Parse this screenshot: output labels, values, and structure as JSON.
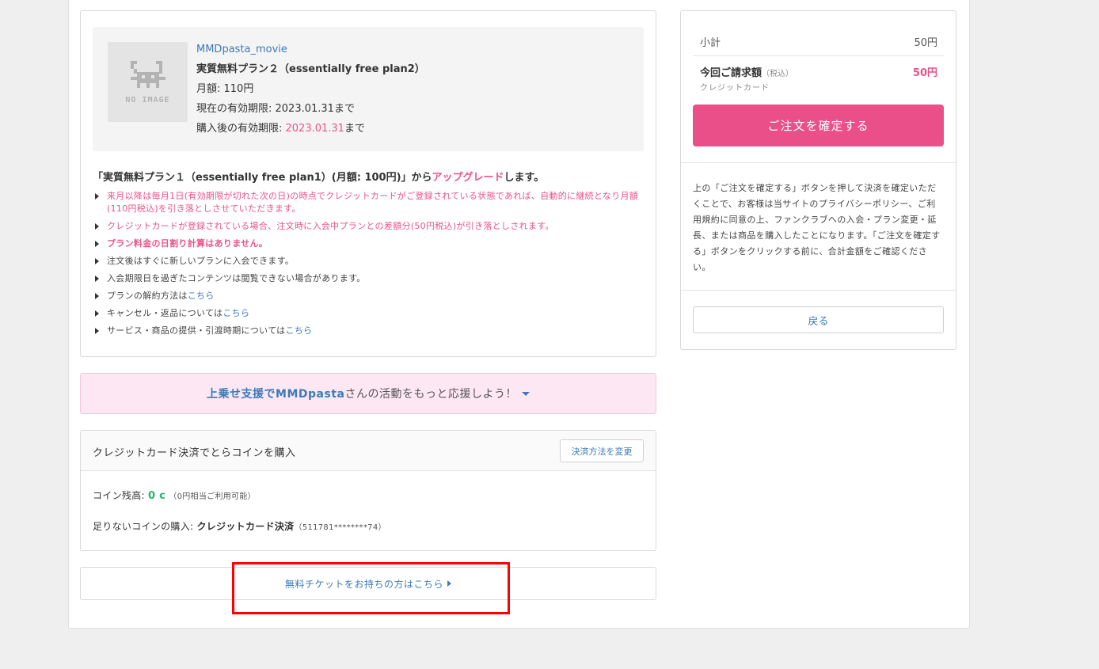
{
  "product": {
    "image_text": "NO IMAGE",
    "creator": "MMDpasta_movie",
    "plan_name": "実質無料プラン２（essentially free plan2）",
    "monthly_label": "月額: ",
    "monthly_value": "110円",
    "current_expiry_label": "現在の有効期限: ",
    "current_expiry_value": "2023.01.31",
    "current_expiry_suffix": "まで",
    "after_expiry_label": "購入後の有効期限: ",
    "after_expiry_value": "2023.01.31",
    "after_expiry_suffix": "まで"
  },
  "upgrade": {
    "prefix": "「実質無料プラン１（essentially free plan1）(月額: 100円)」から",
    "keyword": "アップグレード",
    "suffix": "します。"
  },
  "notes": [
    {
      "text": "来月以降は毎月1日(有効期限が切れた次の日)の時点でクレジットカードがご登録されている状態であれば、自動的に継続となり月額(110円税込)を引き落としさせていただきます。"
    },
    {
      "text": "クレジットカードが登録されている場合、注文時に入会中プランとの差額分(50円税込)が引き落としされます。"
    },
    {
      "text": "プラン料金の日割り計算はありません。"
    },
    {
      "text": "注文後はすぐに新しいプランに入会できます。"
    },
    {
      "text": "入会期限日を過ぎたコンテンツは閲覧できない場合があります。"
    },
    {
      "text": "プランの解約方法は",
      "link": "こちら"
    },
    {
      "text": "キャンセル・返品については",
      "link": "こちら"
    },
    {
      "text": "サービス・商品の提供・引渡時期については",
      "link": "こちら"
    }
  ],
  "promo": {
    "highlight": "上乗せ支援でMMDpasta",
    "text": "さんの活動をもっと応援しよう！"
  },
  "coin": {
    "title": "クレジットカード決済でとらコインを購入",
    "change_button": "決済方法を変更",
    "balance_label": "コイン残高: ",
    "balance_value": "0 c",
    "balance_note": "（0円相当ご利用可能）",
    "purchase_label": "足りないコインの購入: ",
    "purchase_method": "クレジットカード決済",
    "card_number": "（511781********74）"
  },
  "ticket": {
    "label": "無料チケットをお持ちの方はこちら"
  },
  "summary": {
    "subtotal_label": "小計",
    "subtotal_value": "50円",
    "total_label": "今回ご請求額",
    "total_tax": "（税込）",
    "total_value": "50円",
    "payment_method": "クレジットカード",
    "confirm_button": "ご注文を確定する",
    "terms": "上の「ご注文を確定する」ボタンを押して決済を確定いただくことで、お客様は当サイトのプライバシーポリシー、ご利用規約に同意の上、ファンクラブへの入会・プラン変更・延長、または商品を購入したことになります。「ご注文を確定する」ボタンをクリックする前に、合計金額をご確認ください。",
    "back_button": "戻る"
  },
  "colors": {
    "accent_pink": "#ea4f8a",
    "link_blue": "#3d7ab8",
    "coin_green": "#27b36b",
    "highlight_red": "#ff0000"
  }
}
